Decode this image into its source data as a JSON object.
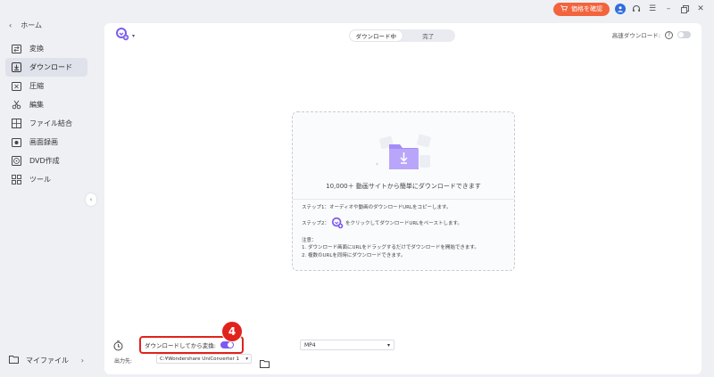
{
  "sidebar": {
    "home": {
      "label": "ホーム",
      "icon": "back-arrow-icon"
    },
    "items": [
      {
        "label": "変換",
        "icon": "convert-icon"
      },
      {
        "label": "ダウンロード",
        "icon": "download-icon",
        "active": true
      },
      {
        "label": "圧縮",
        "icon": "compress-icon"
      },
      {
        "label": "編集",
        "icon": "scissors-icon"
      },
      {
        "label": "ファイル結合",
        "icon": "merge-icon"
      },
      {
        "label": "画面録画",
        "icon": "record-icon"
      },
      {
        "label": "DVD作成",
        "icon": "dvd-icon"
      },
      {
        "label": "ツール",
        "icon": "tools-icon"
      }
    ],
    "my_files": {
      "label": "マイファイル",
      "icon": "folder-icon"
    }
  },
  "topbar": {
    "price_button": "価格を確認"
  },
  "main": {
    "tabs": [
      {
        "label": "ダウンロード中",
        "active": true
      },
      {
        "label": "完了",
        "active": false
      }
    ],
    "high_speed_label": "高速ダウンロード:",
    "dropzone": {
      "caption": "10,000＋ 動画サイトから簡単にダウンロードできます",
      "step1": "ステップ1：オーディオや動画のダウンロードURLをコピーします。",
      "step2_prefix": "ステップ2：",
      "step2_suffix": "をクリックしてダウンロードURLをペーストします。",
      "note_title": "注意：",
      "note1": "1. ダウンロード画面にURLをドラッグするだけでダウンロードを開始できます。",
      "note2": "2. 複数のURLを同時にダウンロードできます。"
    },
    "bottom": {
      "convert_label": "ダウンロードしてから変換:",
      "badge": "4",
      "format_value": "MP4",
      "output_label": "出力先:",
      "output_path": "C:¥Wondershare UniConverter 1"
    }
  },
  "colors": {
    "accent": "#7b5cf0",
    "price": "#f2643d",
    "highlight": "#e0231c"
  }
}
